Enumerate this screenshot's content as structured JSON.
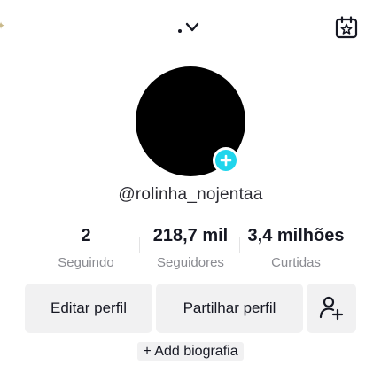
{
  "header": {
    "account_switcher_icon": "chevron-down-icon",
    "calendar_icon": "calendar-star-icon"
  },
  "profile": {
    "avatar_color": "#000000",
    "add_badge_color": "#20d5ec",
    "username": "@rolinha_nojentaa"
  },
  "stats": [
    {
      "value": "2",
      "label": "Seguindo"
    },
    {
      "value": "218,7 mil",
      "label": "Seguidores"
    },
    {
      "value": "3,4 milhões",
      "label": "Curtidas"
    }
  ],
  "actions": {
    "edit_profile": "Editar perfil",
    "share_profile": "Partilhar perfil",
    "add_friend_icon": "add-user-icon"
  },
  "bio": {
    "add_label": "+ Add biografia"
  }
}
